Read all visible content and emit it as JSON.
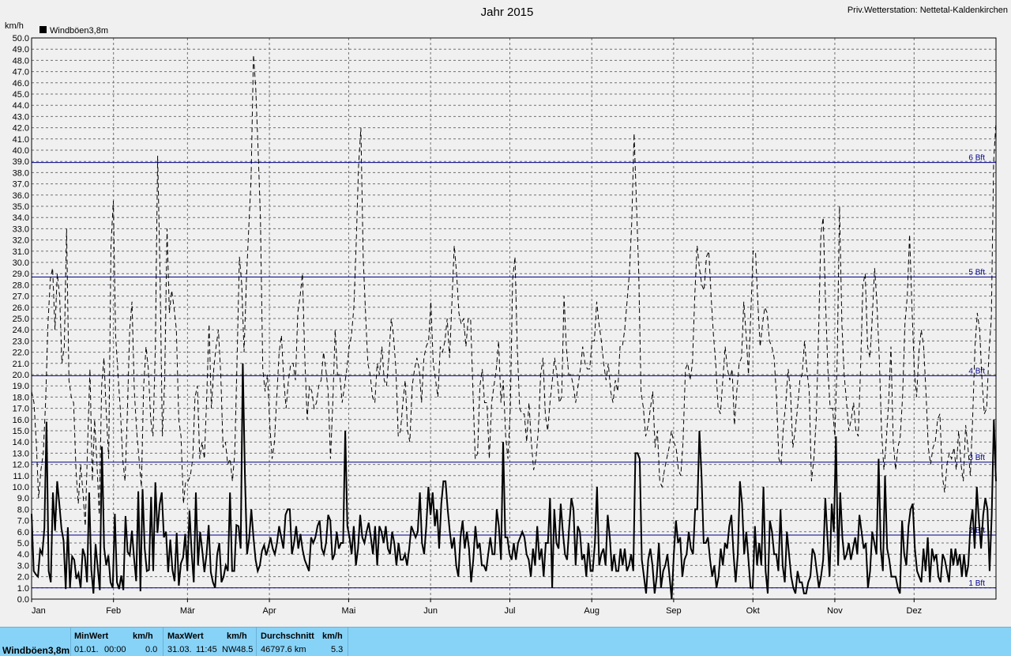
{
  "header": {
    "title": "Jahr 2015",
    "station": "Priv.Wetterstation: Nettetal-Kaldenkirchen",
    "unit": "km/h"
  },
  "legend": {
    "label": "Windböen3,8m",
    "color": "#000000"
  },
  "chart_data": {
    "type": "line",
    "title": "Jahr 2015",
    "ylabel": "km/h",
    "ylim": [
      0,
      50
    ],
    "y_step": 1,
    "x_range_days": [
      0,
      365
    ],
    "x_categories": [
      "Jan",
      "Feb",
      "Mär",
      "Apr",
      "Mai",
      "Jun",
      "Jul",
      "Aug",
      "Sep",
      "Okt",
      "Nov",
      "Dez"
    ],
    "x_category_start_day": [
      0,
      31,
      59,
      90,
      120,
      151,
      181,
      212,
      243,
      273,
      304,
      334
    ],
    "grid": true,
    "legend_position": "top-left",
    "reference_lines": [
      {
        "label": "1 Bft",
        "value": 1.0
      },
      {
        "label": "2 Bft",
        "value": 5.7
      },
      {
        "label": "3 Bft",
        "value": 12.2
      },
      {
        "label": "4 Bft",
        "value": 19.9
      },
      {
        "label": "5 Bft",
        "value": 28.7
      },
      {
        "label": "6 Bft",
        "value": 38.9
      }
    ],
    "series": [
      {
        "name": "Windböen3,8m",
        "style": "solid",
        "values": [
          7.6,
          2.5,
          2.2,
          2.0,
          4.4,
          4.0,
          6.3,
          15.8,
          2.5,
          1.5,
          9.5,
          6.1,
          10.5,
          8.5,
          6.3,
          5.2,
          0.9,
          6.4,
          1.0,
          3.8,
          3.5,
          1.8,
          2.3,
          1.0,
          4.5,
          3.8,
          1.5,
          9.5,
          2.6,
          0.5,
          4.9,
          2.8,
          0.8,
          13.6,
          4.6,
          3.0,
          3.9,
          1.5,
          1.0,
          7.6,
          1.5,
          0.9,
          2.1,
          0.8,
          7.4,
          4.2,
          3.9,
          6.1,
          3.7,
          1.6,
          9.6,
          0.7,
          9.8,
          4.5,
          2.5,
          2.6,
          9.1,
          2.5,
          10.4,
          5.9,
          8.4,
          9.5,
          5.5,
          6.0,
          2.4,
          5.3,
          2.6,
          1.6,
          5.9,
          1.2,
          3.2,
          3.7,
          5.8,
          2.5,
          7.9,
          4.2,
          1.5,
          9.5,
          3.0,
          6.0,
          4.3,
          2.4,
          4.0,
          6.6,
          2.4,
          1.5,
          1.0,
          4.0,
          5.0,
          1.5,
          2.0,
          3.0,
          2.5,
          9.5,
          2.5,
          2.5,
          6.6,
          6.5,
          4.5,
          21.0,
          11.0,
          4.0,
          5.4,
          8.0,
          5.5,
          3.5,
          2.5,
          3.0,
          4.3,
          4.8,
          3.9,
          4.6,
          5.5,
          4.5,
          4.0,
          5.0,
          6.5,
          5.5,
          4.5,
          7.5,
          8.0,
          8.0,
          4.0,
          5.0,
          6.5,
          4.5,
          5.8,
          4.4,
          3.5,
          3.0,
          2.5,
          5.5,
          5.0,
          5.5,
          6.5,
          7.0,
          4.5,
          4.0,
          5.0,
          7.5,
          7.0,
          3.5,
          4.0,
          6.0,
          4.5,
          5.0,
          5.0,
          15.0,
          6.5,
          5.5,
          4.0,
          6.5,
          3.0,
          4.5,
          7.5,
          5.5,
          5.0,
          6.0,
          6.8,
          5.5,
          4.0,
          6.5,
          3.0,
          6.5,
          6.0,
          5.0,
          6.5,
          4.5,
          4.0,
          6.0,
          5.0,
          3.0,
          5.0,
          3.5,
          3.5,
          4.0,
          3.0,
          4.5,
          6.5,
          6.0,
          5.5,
          6.0,
          9.5,
          5.0,
          4.0,
          6.5,
          10.0,
          7.5,
          9.5,
          6.5,
          8.0,
          4.5,
          8.5,
          10.5,
          10.5,
          8.0,
          6.0,
          4.5,
          5.5,
          3.0,
          2.0,
          5.5,
          7.0,
          4.5,
          6.0,
          4.5,
          1.5,
          3.5,
          6.5,
          4.5,
          5.0,
          3.0,
          3.0,
          2.5,
          4.0,
          5.5,
          4.0,
          4.0,
          8.0,
          6.5,
          3.5,
          14.0,
          5.5,
          5.5,
          4.0,
          3.5,
          5.0,
          3.5,
          5.0,
          5.5,
          6.0,
          5.5,
          4.0,
          3.5,
          2.0,
          4.5,
          3.0,
          6.5,
          3.5,
          4.5,
          2.0,
          5.0,
          5.0,
          9.0,
          1.0,
          8.0,
          5.0,
          4.5,
          8.5,
          6.0,
          4.0,
          3.5,
          6.5,
          9.0,
          8.0,
          3.0,
          6.5,
          6.0,
          3.5,
          4.0,
          2.0,
          5.0,
          2.5,
          2.5,
          5.0,
          10.0,
          3.0,
          4.0,
          4.5,
          3.0,
          7.5,
          5.5,
          2.5,
          4.0,
          2.5,
          2.5,
          4.5,
          3.0,
          4.5,
          2.5,
          3.0,
          4.0,
          2.5,
          13.0,
          13.0,
          12.5,
          3.5,
          2.0,
          0.5,
          3.5,
          4.5,
          3.0,
          0.5,
          2.0,
          5.0,
          1.0,
          2.5,
          3.0,
          4.0,
          2.0,
          0.0,
          4.0,
          7.0,
          5.0,
          5.5,
          2.0,
          3.5,
          4.0,
          6.0,
          4.5,
          4.0,
          8.0,
          8.0,
          15.0,
          11.0,
          5.0,
          5.0,
          5.5,
          3.5,
          2.0,
          3.0,
          1.0,
          2.0,
          4.5,
          3.0,
          5.0,
          4.5,
          6.5,
          7.5,
          4.0,
          1.5,
          4.0,
          10.5,
          8.5,
          4.0,
          6.0,
          3.5,
          1.0,
          1.0,
          6.5,
          3.0,
          5.0,
          3.0,
          10.0,
          2.5,
          0.5,
          7.0,
          6.0,
          4.0,
          4.0,
          2.5,
          8.0,
          3.0,
          1.5,
          6.0,
          4.0,
          2.0,
          1.0,
          0.5,
          2.5,
          1.5,
          1.5,
          0.5,
          0.5,
          1.5,
          2.0,
          4.5,
          4.0,
          2.5,
          1.0,
          2.0,
          3.5,
          9.0,
          5.5,
          2.0,
          8.5,
          6.0,
          14.5,
          3.0,
          9.5,
          5.5,
          3.5,
          4.0,
          5.0,
          3.5,
          4.5,
          5.5,
          4.0,
          7.5,
          6.0,
          4.5,
          5.0,
          1.0,
          2.5,
          6.0,
          5.0,
          4.0,
          12.5,
          4.5,
          2.5,
          11.0,
          4.5,
          3.5,
          2.0,
          2.0,
          2.0,
          1.0,
          0.5,
          7.0,
          4.0,
          3.0,
          6.5,
          8.0,
          8.5,
          4.5,
          2.5,
          2.0,
          1.5,
          4.5,
          2.5,
          5.5,
          1.5,
          4.5,
          3.5,
          4.0,
          2.0,
          1.5,
          4.0,
          3.5,
          2.5,
          1.5,
          4.5,
          3.0,
          4.5,
          3.0,
          4.0,
          2.0,
          4.0,
          2.0,
          3.0,
          6.5,
          8.0,
          4.5,
          10.0,
          7.0,
          4.5,
          7.5,
          9.0,
          8.0,
          2.5,
          7.5,
          16.0,
          10.5
        ]
      },
      {
        "name": "Windböen3,8m (dashed)",
        "style": "dashed",
        "values": [
          18.5,
          17.5,
          14.0,
          9.0,
          11.5,
          13.0,
          17.5,
          24.5,
          28.5,
          29.5,
          24.0,
          29.0,
          27.0,
          21.0,
          22.5,
          33.0,
          19.5,
          18.0,
          17.5,
          11.5,
          8.5,
          12.0,
          9.5,
          6.5,
          14.0,
          20.5,
          10.5,
          16.0,
          12.0,
          7.5,
          19.0,
          21.5,
          16.5,
          12.5,
          31.5,
          35.5,
          23.5,
          20.0,
          17.0,
          12.5,
          10.5,
          16.5,
          24.0,
          26.5,
          18.5,
          15.0,
          12.5,
          10.0,
          19.0,
          22.5,
          20.5,
          16.0,
          14.5,
          22.5,
          39.5,
          29.0,
          14.5,
          19.5,
          33.0,
          25.5,
          27.5,
          26.0,
          24.0,
          16.0,
          14.5,
          8.5,
          10.5,
          10.5,
          11.0,
          12.5,
          18.0,
          19.0,
          12.5,
          14.0,
          12.5,
          18.0,
          24.5,
          17.0,
          20.5,
          22.5,
          24.0,
          20.0,
          13.5,
          14.0,
          12.0,
          12.5,
          10.5,
          13.0,
          21.5,
          30.5,
          28.0,
          22.0,
          28.5,
          33.0,
          37.5,
          48.5,
          45.5,
          40.0,
          34.0,
          20.5,
          18.5,
          20.0,
          15.5,
          12.5,
          14.0,
          18.0,
          22.0,
          23.5,
          19.5,
          17.0,
          19.5,
          21.0,
          21.0,
          19.5,
          25.5,
          27.0,
          29.0,
          21.5,
          16.0,
          19.0,
          18.5,
          17.0,
          17.5,
          19.0,
          19.5,
          22.0,
          20.5,
          18.5,
          12.5,
          17.5,
          24.0,
          20.0,
          20.0,
          17.5,
          19.0,
          20.5,
          22.5,
          23.5,
          26.0,
          31.5,
          38.5,
          42.0,
          30.5,
          25.5,
          21.0,
          20.0,
          18.0,
          17.5,
          21.0,
          20.0,
          22.5,
          19.5,
          19.0,
          21.5,
          25.0,
          23.5,
          20.5,
          14.5,
          15.0,
          17.5,
          19.5,
          15.0,
          14.0,
          19.0,
          20.5,
          21.5,
          20.5,
          17.5,
          21.5,
          22.5,
          23.0,
          26.5,
          21.0,
          19.5,
          18.0,
          22.5,
          22.0,
          23.0,
          25.0,
          21.5,
          26.5,
          31.5,
          29.0,
          25.5,
          24.5,
          25.0,
          22.5,
          25.0,
          25.0,
          18.5,
          12.5,
          13.0,
          19.0,
          20.5,
          17.5,
          17.5,
          12.5,
          17.5,
          19.0,
          20.5,
          23.0,
          17.5,
          19.5,
          14.5,
          12.5,
          17.0,
          28.5,
          30.5,
          22.5,
          17.0,
          16.5,
          16.5,
          14.0,
          17.5,
          14.0,
          11.5,
          12.5,
          15.0,
          20.0,
          21.5,
          16.5,
          15.0,
          17.5,
          19.5,
          21.5,
          20.0,
          17.5,
          18.0,
          27.0,
          22.5,
          20.0,
          20.0,
          19.0,
          17.5,
          19.0,
          20.5,
          22.5,
          21.0,
          20.5,
          20.5,
          23.0,
          23.0,
          26.5,
          24.5,
          23.0,
          21.0,
          19.5,
          21.0,
          18.5,
          17.5,
          19.5,
          18.5,
          22.5,
          22.5,
          24.0,
          26.5,
          29.0,
          33.5,
          41.5,
          35.5,
          29.0,
          18.5,
          17.0,
          14.5,
          15.5,
          17.0,
          18.5,
          13.5,
          15.0,
          10.5,
          10.0,
          11.5,
          12.5,
          13.5,
          15.0,
          14.0,
          13.5,
          11.5,
          11.0,
          14.0,
          20.5,
          21.0,
          19.5,
          21.0,
          27.0,
          31.5,
          29.5,
          28.0,
          27.5,
          30.5,
          31.0,
          27.0,
          23.5,
          21.0,
          17.0,
          16.5,
          19.5,
          22.5,
          20.5,
          19.5,
          20.5,
          15.5,
          18.5,
          21.0,
          21.5,
          26.5,
          23.5,
          20.0,
          25.5,
          31.0,
          31.0,
          26.5,
          22.5,
          24.5,
          26.0,
          25.5,
          23.0,
          22.5,
          21.5,
          18.0,
          12.5,
          12.0,
          15.5,
          17.5,
          20.5,
          18.5,
          13.5,
          15.0,
          17.0,
          19.5,
          20.0,
          23.0,
          20.5,
          18.5,
          10.5,
          12.5,
          16.0,
          23.5,
          32.5,
          34.0,
          26.5,
          20.5,
          17.0,
          17.0,
          14.5,
          21.5,
          35.0,
          24.5,
          20.0,
          17.5,
          15.0,
          16.0,
          17.5,
          15.0,
          14.5,
          20.5,
          28.0,
          29.0,
          22.5,
          21.5,
          25.0,
          29.5,
          26.5,
          21.5,
          15.0,
          11.5,
          14.0,
          17.5,
          22.5,
          14.0,
          11.5,
          13.5,
          14.5,
          18.0,
          24.5,
          27.0,
          32.5,
          26.0,
          20.5,
          18.0,
          22.0,
          24.0,
          22.5,
          18.5,
          13.5,
          12.0,
          13.5,
          14.0,
          16.0,
          16.5,
          11.0,
          9.5,
          12.0,
          13.0,
          12.5,
          13.5,
          11.5,
          15.0,
          12.0,
          10.5,
          15.5,
          13.5,
          11.0,
          16.0,
          22.5,
          25.5,
          24.0,
          19.5,
          16.5,
          17.0,
          22.0,
          25.0,
          39.0,
          42.5
        ]
      }
    ]
  },
  "stats": {
    "series_name": "Windböen3,8m",
    "min": {
      "label": "MinWert",
      "unit": "km/h",
      "date": "01.01.",
      "time": "00:00",
      "value": "0.0"
    },
    "max": {
      "label": "MaxWert",
      "unit": "km/h",
      "date": "31.03.",
      "time": "11:45",
      "dir": "NW",
      "value": "48.5"
    },
    "avg": {
      "label": "Durchschnitt",
      "unit": "km/h",
      "distance": "46797.6 km",
      "value": "5.3"
    }
  }
}
